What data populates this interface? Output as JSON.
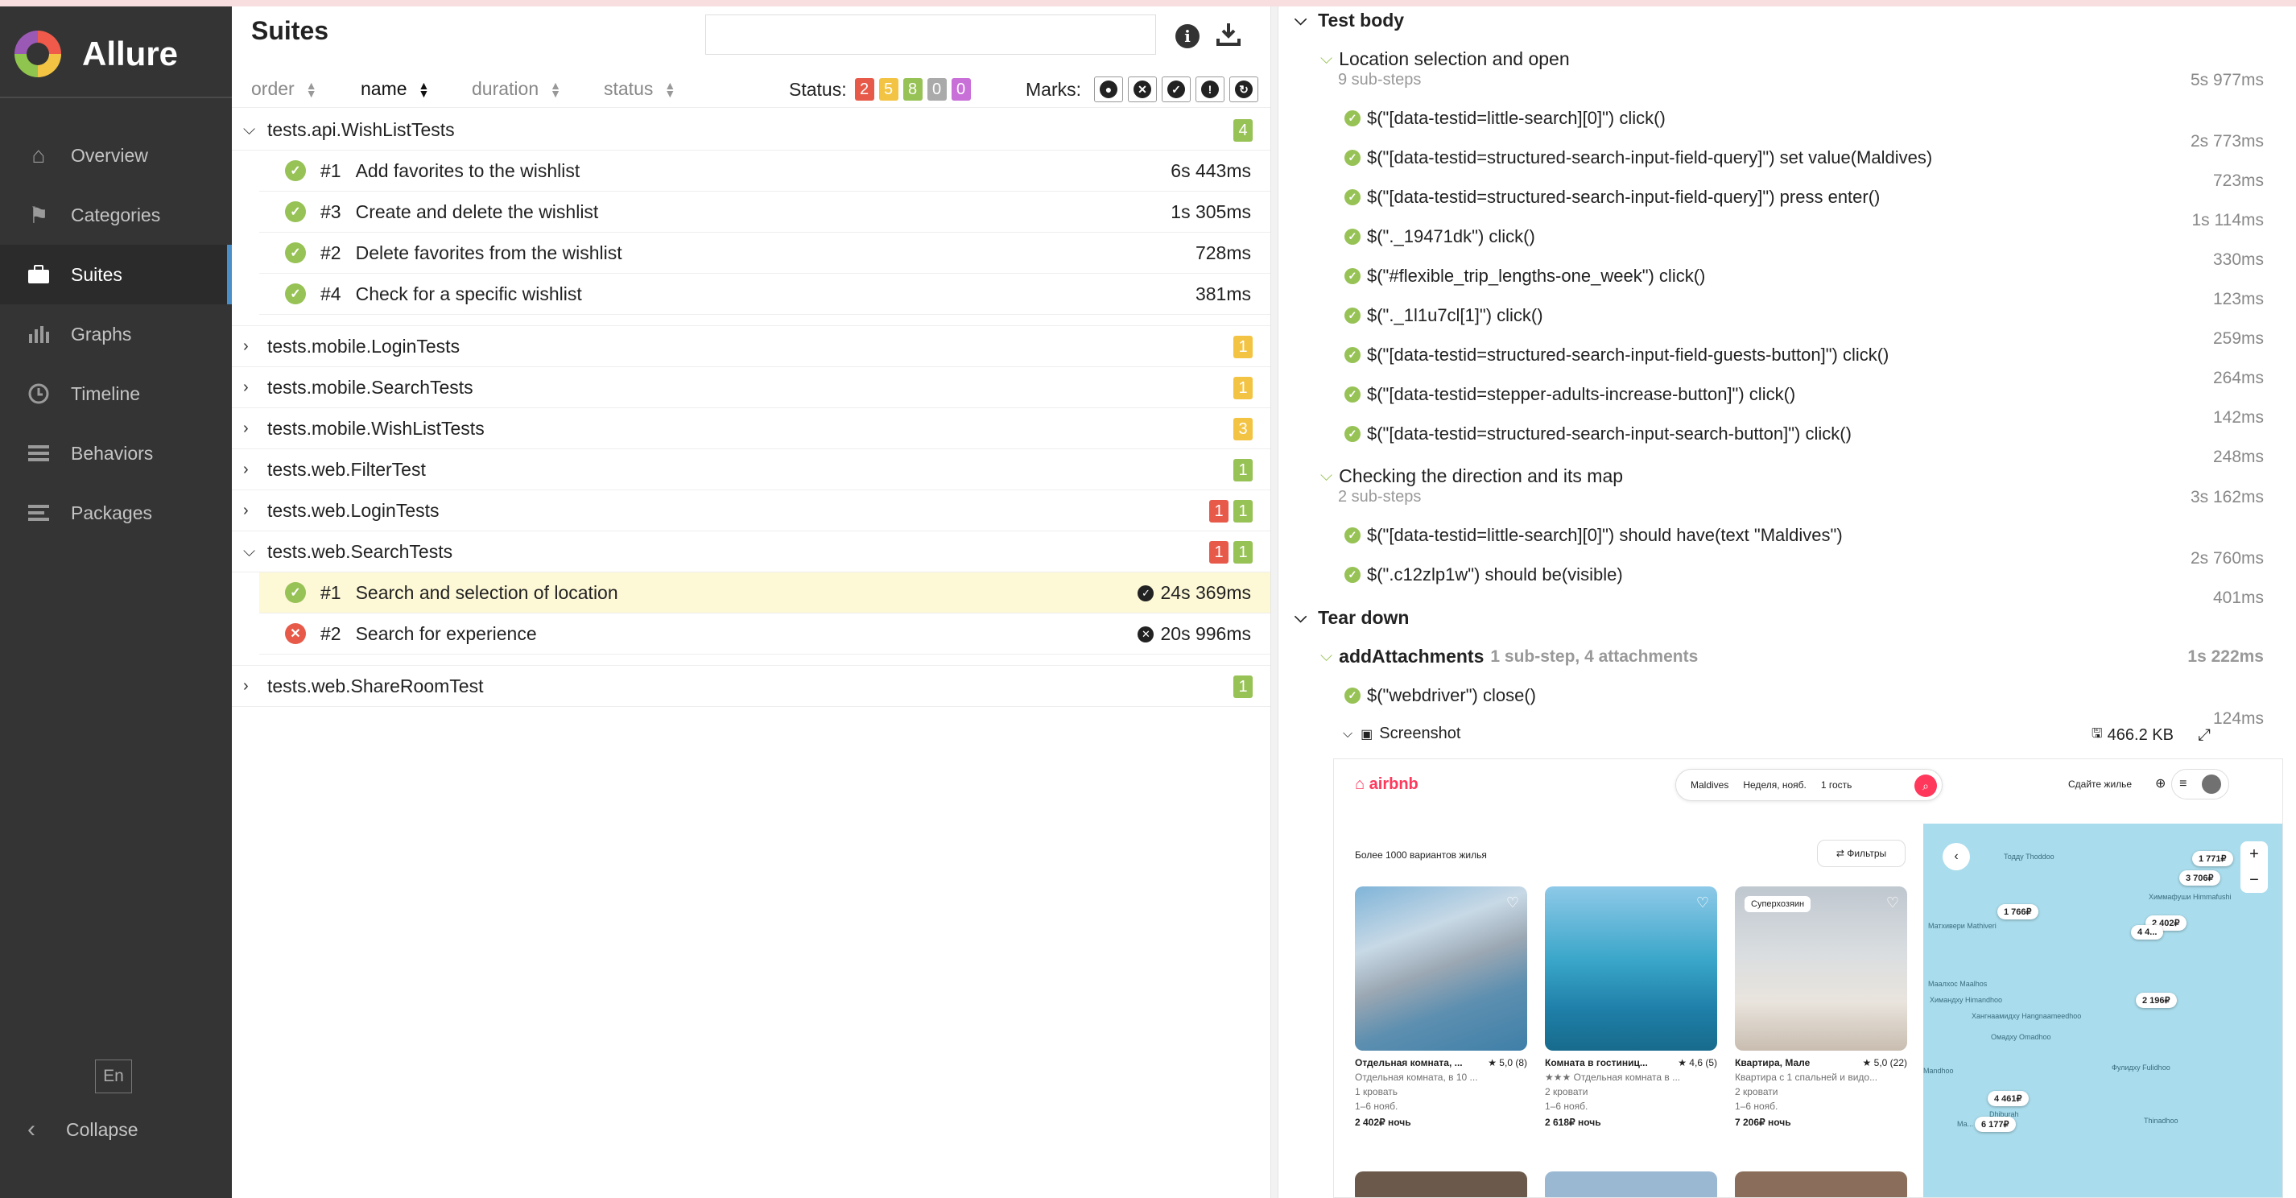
{
  "app": {
    "name": "Allure"
  },
  "sidebar": {
    "items": [
      {
        "label": "Overview",
        "icon": "home-icon"
      },
      {
        "label": "Categories",
        "icon": "flag-icon"
      },
      {
        "label": "Suites",
        "icon": "briefcase-icon"
      },
      {
        "label": "Graphs",
        "icon": "bar-chart-icon"
      },
      {
        "label": "Timeline",
        "icon": "clock-icon"
      },
      {
        "label": "Behaviors",
        "icon": "list-icon"
      },
      {
        "label": "Packages",
        "icon": "align-left-icon"
      }
    ],
    "active": "Suites",
    "lang": "En",
    "collapse": "Collapse"
  },
  "suites": {
    "title": "Suites",
    "search_value": "",
    "sort": {
      "order": "order",
      "name": "name",
      "duration": "duration",
      "status": "status"
    },
    "status_label": "Status:",
    "status_counts": {
      "failed": "2",
      "broken": "5",
      "passed": "8",
      "skipped": "0",
      "unknown": "0"
    },
    "marks_label": "Marks:",
    "groups": [
      {
        "name": "tests.api.WishListTests",
        "expanded": true,
        "counts": [
          {
            "v": "4",
            "c": "green"
          }
        ],
        "cases": [
          {
            "num": "#1",
            "name": "Add favorites to the wishlist",
            "duration": "6s 443ms",
            "status": "passed"
          },
          {
            "num": "#3",
            "name": "Create and delete the wishlist",
            "duration": "1s 305ms",
            "status": "passed"
          },
          {
            "num": "#2",
            "name": "Delete favorites from the wishlist",
            "duration": "728ms",
            "status": "passed"
          },
          {
            "num": "#4",
            "name": "Check for a specific wishlist",
            "duration": "381ms",
            "status": "passed"
          }
        ]
      },
      {
        "name": "tests.mobile.LoginTests",
        "expanded": false,
        "counts": [
          {
            "v": "1",
            "c": "yellow"
          }
        ]
      },
      {
        "name": "tests.mobile.SearchTests",
        "expanded": false,
        "counts": [
          {
            "v": "1",
            "c": "yellow"
          }
        ]
      },
      {
        "name": "tests.mobile.WishListTests",
        "expanded": false,
        "counts": [
          {
            "v": "3",
            "c": "yellow"
          }
        ]
      },
      {
        "name": "tests.web.FilterTest",
        "expanded": false,
        "counts": [
          {
            "v": "1",
            "c": "green"
          }
        ]
      },
      {
        "name": "tests.web.LoginTests",
        "expanded": false,
        "counts": [
          {
            "v": "1",
            "c": "red"
          },
          {
            "v": "1",
            "c": "green"
          }
        ]
      },
      {
        "name": "tests.web.SearchTests",
        "expanded": true,
        "counts": [
          {
            "v": "1",
            "c": "red"
          },
          {
            "v": "1",
            "c": "green"
          }
        ],
        "cases": [
          {
            "num": "#1",
            "name": "Search and selection of location",
            "duration": "24s 369ms",
            "status": "passed",
            "selected": true
          },
          {
            "num": "#2",
            "name": "Search for experience",
            "duration": "20s 996ms",
            "status": "failed"
          }
        ]
      },
      {
        "name": "tests.web.ShareRoomTest",
        "expanded": false,
        "counts": [
          {
            "v": "1",
            "c": "green"
          }
        ]
      }
    ]
  },
  "detail": {
    "test_body": "Test body",
    "tear_down": "Tear down",
    "step1": {
      "title": "Location selection and open",
      "sub": "9 sub-steps",
      "time": "5s 977ms"
    },
    "step1_children": [
      {
        "label": "$(\"[data-testid=little-search][0]\") click()",
        "time": "2s 773ms"
      },
      {
        "label": "$(\"[data-testid=structured-search-input-field-query]\") set value(Maldives)",
        "time": "723ms"
      },
      {
        "label": "$(\"[data-testid=structured-search-input-field-query]\") press enter()",
        "time": "1s 114ms"
      },
      {
        "label": "$(\"._19471dk\") click()",
        "time": "330ms"
      },
      {
        "label": "$(\"#flexible_trip_lengths-one_week\") click()",
        "time": "123ms"
      },
      {
        "label": "$(\"._1l1u7cl[1]\") click()",
        "time": "259ms"
      },
      {
        "label": "$(\"[data-testid=structured-search-input-field-guests-button]\") click()",
        "time": "264ms"
      },
      {
        "label": "$(\"[data-testid=stepper-adults-increase-button]\") click()",
        "time": "142ms"
      },
      {
        "label": "$(\"[data-testid=structured-search-input-search-button]\") click()",
        "time": "248ms"
      }
    ],
    "step2": {
      "title": "Checking the direction and its map",
      "sub": "2 sub-steps",
      "time": "3s 162ms"
    },
    "step2_children": [
      {
        "label": "$(\"[data-testid=little-search][0]\") should have(text \"Maldives\")",
        "time": "2s 760ms"
      },
      {
        "label": "$(\".c12zlp1w\") should be(visible)",
        "time": "401ms"
      }
    ],
    "attach": {
      "title": "addAttachments",
      "meta": "1 sub-step, 4 attachments",
      "time": "1s 222ms"
    },
    "attach_children": [
      {
        "label": "$(\"webdriver\") close()",
        "time": "124ms"
      }
    ],
    "screenshot_label": "Screenshot",
    "screenshot_size": "466.2 KB"
  },
  "airbnb": {
    "logo": "airbnb",
    "search": [
      "Maldives",
      "Неделя, нояб.",
      "1 гость"
    ],
    "host": "Сдайте жилье",
    "count": "Более 1000 вариантов жилья",
    "filters": "Фильтры",
    "cards": [
      {
        "title": "Отдельная комната, ...",
        "rating": "★ 5,0 (8)",
        "line1": "Отдельная комната, в 10 ...",
        "line2": "1 кровать",
        "line3": "1–6 нояб.",
        "price": "2 402₽ ночь",
        "tag": ""
      },
      {
        "title": "Комната в гостиниц...",
        "rating": "★ 4,6 (5)",
        "line1": "★★★ Отдельная комната в ...",
        "line2": "2 кровати",
        "line3": "1–6 нояб.",
        "price": "2 618₽ ночь",
        "tag": ""
      },
      {
        "title": "Квартира, Мале",
        "rating": "★ 5,0 (22)",
        "line1": "Квартира с 1 спальней и видо...",
        "line2": "2 кровати",
        "line3": "1–6 нояб.",
        "price": "7 206₽ ночь",
        "tag": "Суперхозяин"
      }
    ],
    "map_pins": [
      "1 771₽",
      "3 706₽",
      "1 766₽",
      "2 402₽",
      "4 4...",
      "2 196₽",
      "4 461₽",
      "6 177₽"
    ],
    "map_labels": [
      "Тодду Thoddoo",
      "Химмафуши Himmafushi",
      "Матхивери Mathiveri",
      "Маалхос Maalhos",
      "Химандху Himandhoo",
      "Хангнаамидху Hangnaameedhoo",
      "Омадху Omadhoo",
      "Фулидху Fulidhoo",
      "Mandhoo",
      "Dhiburah",
      "Thinadhoo",
      "Ма..."
    ]
  }
}
